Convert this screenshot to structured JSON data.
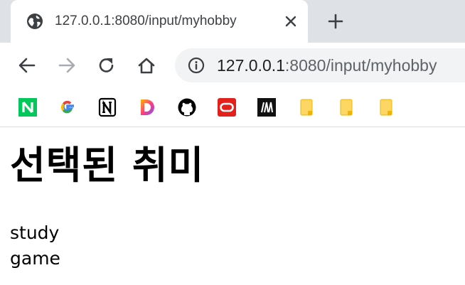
{
  "browser": {
    "tab": {
      "title": "127.0.0.1:8080/input/myhobby",
      "favicon": "globe-icon"
    },
    "new_tab": "+",
    "address": {
      "host": "127.0.0.1",
      "path": ":8080/input/myhobby"
    },
    "bookmarks": [
      {
        "icon": "naver-icon",
        "letter": "N",
        "color": "#03c75a"
      },
      {
        "icon": "google-icon",
        "letter": "G",
        "color": "#4285f4"
      },
      {
        "icon": "notion-icon",
        "letter": "N",
        "color": "#000000"
      },
      {
        "icon": "d-icon",
        "letter": "D",
        "color": "#a142f4"
      },
      {
        "icon": "github-icon",
        "color": "#000000"
      },
      {
        "icon": "oracle-icon",
        "color": "#e2211c"
      },
      {
        "icon": "m-icon",
        "letter": "/M",
        "color": "#111111"
      },
      {
        "icon": "folder-icon",
        "color": "#fdd663"
      },
      {
        "icon": "folder-icon",
        "color": "#fdd663"
      },
      {
        "icon": "folder-icon",
        "color": "#fdd663"
      }
    ]
  },
  "page": {
    "heading": "선택된 취미",
    "hobbies": [
      "study",
      "game"
    ]
  }
}
